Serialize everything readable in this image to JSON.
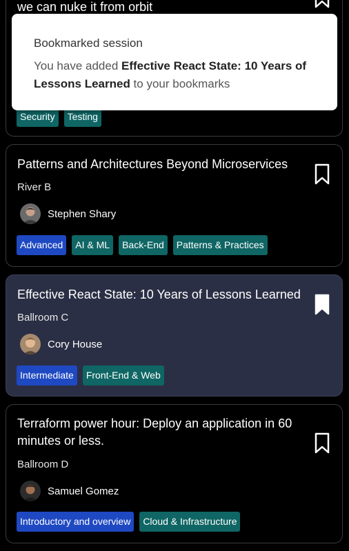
{
  "sessions": [
    {
      "title": "we can nuke it from orbit",
      "room": "",
      "speaker": "",
      "tags": [
        {
          "label": "Security",
          "kind": "topic"
        },
        {
          "label": "Testing",
          "kind": "topic"
        }
      ],
      "bookmarked": false
    },
    {
      "title": "Patterns and Architectures Beyond Microservices",
      "room": "River B",
      "speaker": "Stephen Shary",
      "tags": [
        {
          "label": "Advanced",
          "kind": "level"
        },
        {
          "label": "AI & ML",
          "kind": "topic"
        },
        {
          "label": "Back-End",
          "kind": "topic"
        },
        {
          "label": "Patterns & Practices",
          "kind": "topic"
        }
      ],
      "bookmarked": false
    },
    {
      "title": "Effective React State: 10 Years of Lessons Learned",
      "room": "Ballroom C",
      "speaker": "Cory House",
      "tags": [
        {
          "label": "Intermediate",
          "kind": "level"
        },
        {
          "label": "Front-End & Web",
          "kind": "topic"
        }
      ],
      "bookmarked": true
    },
    {
      "title": "Terraform power hour: Deploy an application in 60 minutes or less.",
      "room": "Ballroom D",
      "speaker": "Samuel Gomez",
      "tags": [
        {
          "label": "Introductory and overview",
          "kind": "level"
        },
        {
          "label": "Cloud & Infrastructure",
          "kind": "topic"
        }
      ],
      "bookmarked": false
    }
  ],
  "toast": {
    "title": "Bookmarked session",
    "prefix": "You have added ",
    "session": "Effective React State: 10 Years of Lessons Learned",
    "suffix": " to your bookmarks"
  },
  "colors": {
    "level_tag": "#1f49c2",
    "topic_tag": "#0f6664",
    "active_card": "#2b2f45"
  },
  "icons": {
    "bookmark_outline": "bookmark-outline-icon",
    "bookmark_filled": "bookmark-filled-icon"
  }
}
